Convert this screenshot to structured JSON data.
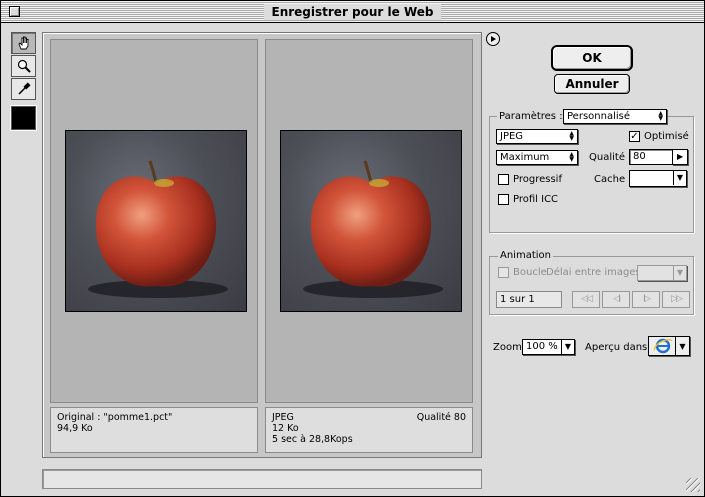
{
  "window": {
    "title": "Enregistrer pour le Web"
  },
  "tools": [
    {
      "name": "hand-tool",
      "icon": "hand-icon"
    },
    {
      "name": "zoom-tool",
      "icon": "magnifier-icon"
    },
    {
      "name": "eyedropper-tool",
      "icon": "eyedropper-icon"
    }
  ],
  "color_swatch": "#000000",
  "preview": {
    "original": {
      "line1": "Original : \"pomme1.pct\"",
      "line2": "94,9 Ko"
    },
    "optimized": {
      "format": "JPEG",
      "quality": "Qualité 80",
      "size": "12 Ko",
      "time": "5 sec à 28,8Kops"
    }
  },
  "buttons": {
    "ok": "OK",
    "cancel": "Annuler"
  },
  "params": {
    "label": "Paramètres :",
    "preset": "Personnalisé",
    "format": "JPEG",
    "optimized_label": "Optimisé",
    "optimized_checked": true,
    "quality_level": "Maximum",
    "quality_label": "Qualité :",
    "quality_value": "80",
    "progressive_label": "Progressif",
    "progressive_checked": false,
    "cache_label": "Cache :",
    "cache_value": "",
    "icc_label": "Profil ICC",
    "icc_checked": false
  },
  "animation": {
    "label": "Animation",
    "loop_label": "Boucle",
    "delay_label": "Délai entre images :",
    "delay_value": "",
    "frame_counter": "1 sur 1",
    "nav": [
      "◁◁",
      "◁I",
      "I▷",
      "▷▷"
    ]
  },
  "zoom": {
    "label": "Zoom:",
    "value": "100 %"
  },
  "preview_in": {
    "label": "Aperçu dans :",
    "browser_icon": "internet-explorer-icon"
  },
  "colors": {
    "window_bg": "#dcdcdc",
    "pane_bg": "#b4b4b4",
    "apple_red": "#c8412e"
  }
}
